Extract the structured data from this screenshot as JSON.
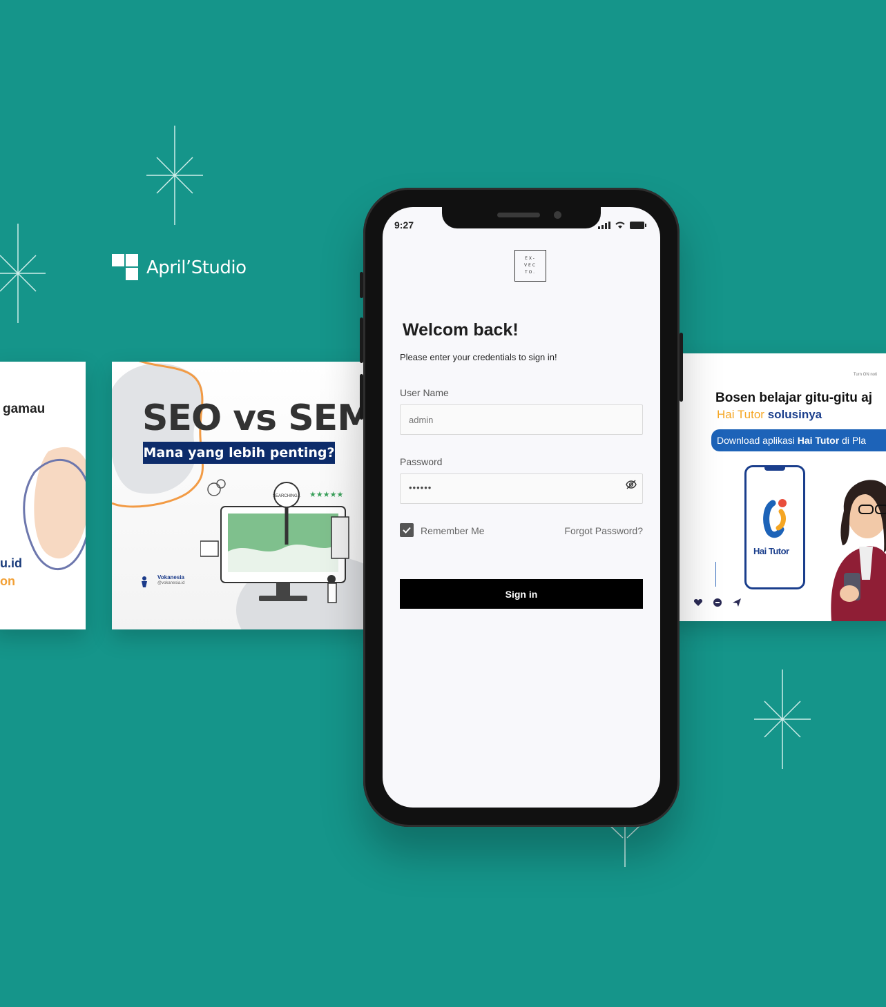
{
  "brand": {
    "name": "April’Studio"
  },
  "phone": {
    "status": {
      "time": "9:27"
    },
    "logo_lines": [
      "EX-",
      "VEC",
      "TO."
    ],
    "welcome_title": "Welcom back!",
    "subtitle": "Please enter your credentials to sign in!",
    "username": {
      "label": "User Name",
      "placeholder": "admin",
      "value": ""
    },
    "password": {
      "label": "Password",
      "value": "••••••"
    },
    "remember_label": "Remember Me",
    "remember_checked": true,
    "forgot_label": "Forgot Password?",
    "signin_label": "Sign in"
  },
  "cards": {
    "left": {
      "line1": "gamau",
      "line2": "u.id",
      "line3": "on"
    },
    "seo": {
      "title": "SEO vs SEM",
      "banner": "Mana yang lebih penting?",
      "search_tag": "SEARCHING...",
      "org_name": "Vokanesia",
      "org_handle": "@vokanesia.id"
    },
    "hai": {
      "top_note": "Turn ON noti",
      "title": "Bosen belajar gitu-gitu aj",
      "sub_prefix": "Hai Tutor",
      "sub_suffix": "solusinya",
      "pill_prefix": "Download aplikasi ",
      "pill_bold": "Hai Tutor",
      "pill_suffix": " di Pla",
      "app_name": "Hai Tutor"
    }
  },
  "colors": {
    "background": "#15958a",
    "navy": "#0d2c6b",
    "orange": "#f5a623",
    "hai_blue": "#1d63b8"
  }
}
